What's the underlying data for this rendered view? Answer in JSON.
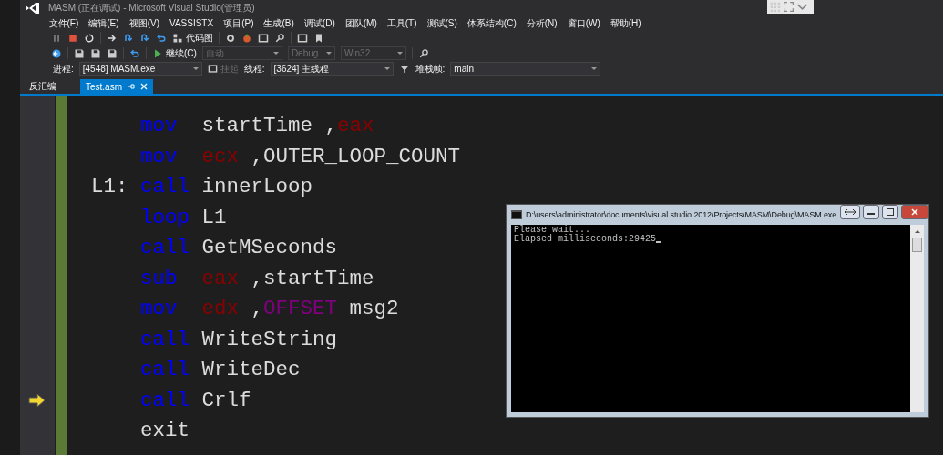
{
  "window": {
    "title": "MASM (正在调试) - Microsoft Visual Studio(管理员)"
  },
  "menu": [
    "文件(F)",
    "编辑(E)",
    "视图(V)",
    "VASSISTX",
    "项目(P)",
    "生成(B)",
    "调试(D)",
    "团队(M)",
    "工具(T)",
    "测试(S)",
    "体系结构(C)",
    "分析(N)",
    "窗口(W)",
    "帮助(H)"
  ],
  "debug_toolbar": {
    "code_map_button": "代码图"
  },
  "standard_toolbar": {
    "continue_button": "继续(C)",
    "dropdowns": [
      {
        "value": "自动",
        "disabled": true
      },
      {
        "value": "Debug",
        "disabled": true
      },
      {
        "value": "Win32",
        "disabled": true
      }
    ]
  },
  "location_toolbar": {
    "process_label": "进程:",
    "process": "[4548] MASM.exe",
    "suspend_button": {
      "label": "挂起",
      "disabled": true
    },
    "thread_label": "线程:",
    "thread": "[3624] 主线程",
    "stack_frame_label": "堆栈帧:",
    "stack_frame": "main"
  },
  "tabs": [
    {
      "label": "反汇编",
      "selected": false
    },
    {
      "label": "Test.asm",
      "selected": true
    }
  ],
  "editor": {
    "lines": [
      {
        "current": false,
        "op": {
          "kind": "keyword",
          "text": "mov"
        },
        "tokens": [
          {
            "kind": "plain",
            "text": "startTime ,"
          },
          {
            "kind": "register",
            "text": "eax"
          }
        ]
      },
      {
        "current": false,
        "op": {
          "kind": "keyword",
          "text": "mov"
        },
        "tokens": [
          {
            "kind": "register",
            "text": "ecx"
          },
          {
            "kind": "plain",
            "text": " ,OUTER_LOOP_COUNT"
          }
        ]
      },
      {
        "label": "L1:",
        "current": false,
        "op": {
          "kind": "keyword",
          "text": "call"
        },
        "tokens": [
          {
            "kind": "plain",
            "text": "innerLoop"
          }
        ]
      },
      {
        "current": false,
        "op": {
          "kind": "keyword",
          "text": "loop"
        },
        "tokens": [
          {
            "kind": "plain",
            "text": "L1"
          }
        ]
      },
      {
        "current": false,
        "op": {
          "kind": "keyword",
          "text": "call"
        },
        "tokens": [
          {
            "kind": "plain",
            "text": "GetMSeconds"
          }
        ]
      },
      {
        "current": false,
        "op": {
          "kind": "keyword",
          "text": "sub"
        },
        "tokens": [
          {
            "kind": "register",
            "text": "eax"
          },
          {
            "kind": "plain",
            "text": " ,startTime"
          }
        ]
      },
      {
        "current": false,
        "op": {
          "kind": "keyword",
          "text": "mov"
        },
        "tokens": [
          {
            "kind": "register",
            "text": "edx"
          },
          {
            "kind": "plain",
            "text": " ,"
          },
          {
            "kind": "directive",
            "text": "OFFSET"
          },
          {
            "kind": "plain",
            "text": " msg2"
          }
        ]
      },
      {
        "current": false,
        "op": {
          "kind": "keyword",
          "text": "call"
        },
        "tokens": [
          {
            "kind": "plain",
            "text": "WriteString"
          }
        ]
      },
      {
        "current": false,
        "op": {
          "kind": "keyword",
          "text": "call"
        },
        "tokens": [
          {
            "kind": "plain",
            "text": "WriteDec"
          }
        ]
      },
      {
        "current": true,
        "op": {
          "kind": "keyword",
          "text": "call"
        },
        "tokens": [
          {
            "kind": "plain",
            "text": "Crlf"
          }
        ]
      },
      {
        "current": false,
        "op": {
          "kind": "plain",
          "text": "exit"
        }
      }
    ]
  },
  "console": {
    "title": "D:\\users\\administrator\\documents\\visual studio 2012\\Projects\\MASM\\Debug\\MASM.exe",
    "lines": [
      "Please wait...",
      "Elapsed milliseconds:29425"
    ]
  }
}
